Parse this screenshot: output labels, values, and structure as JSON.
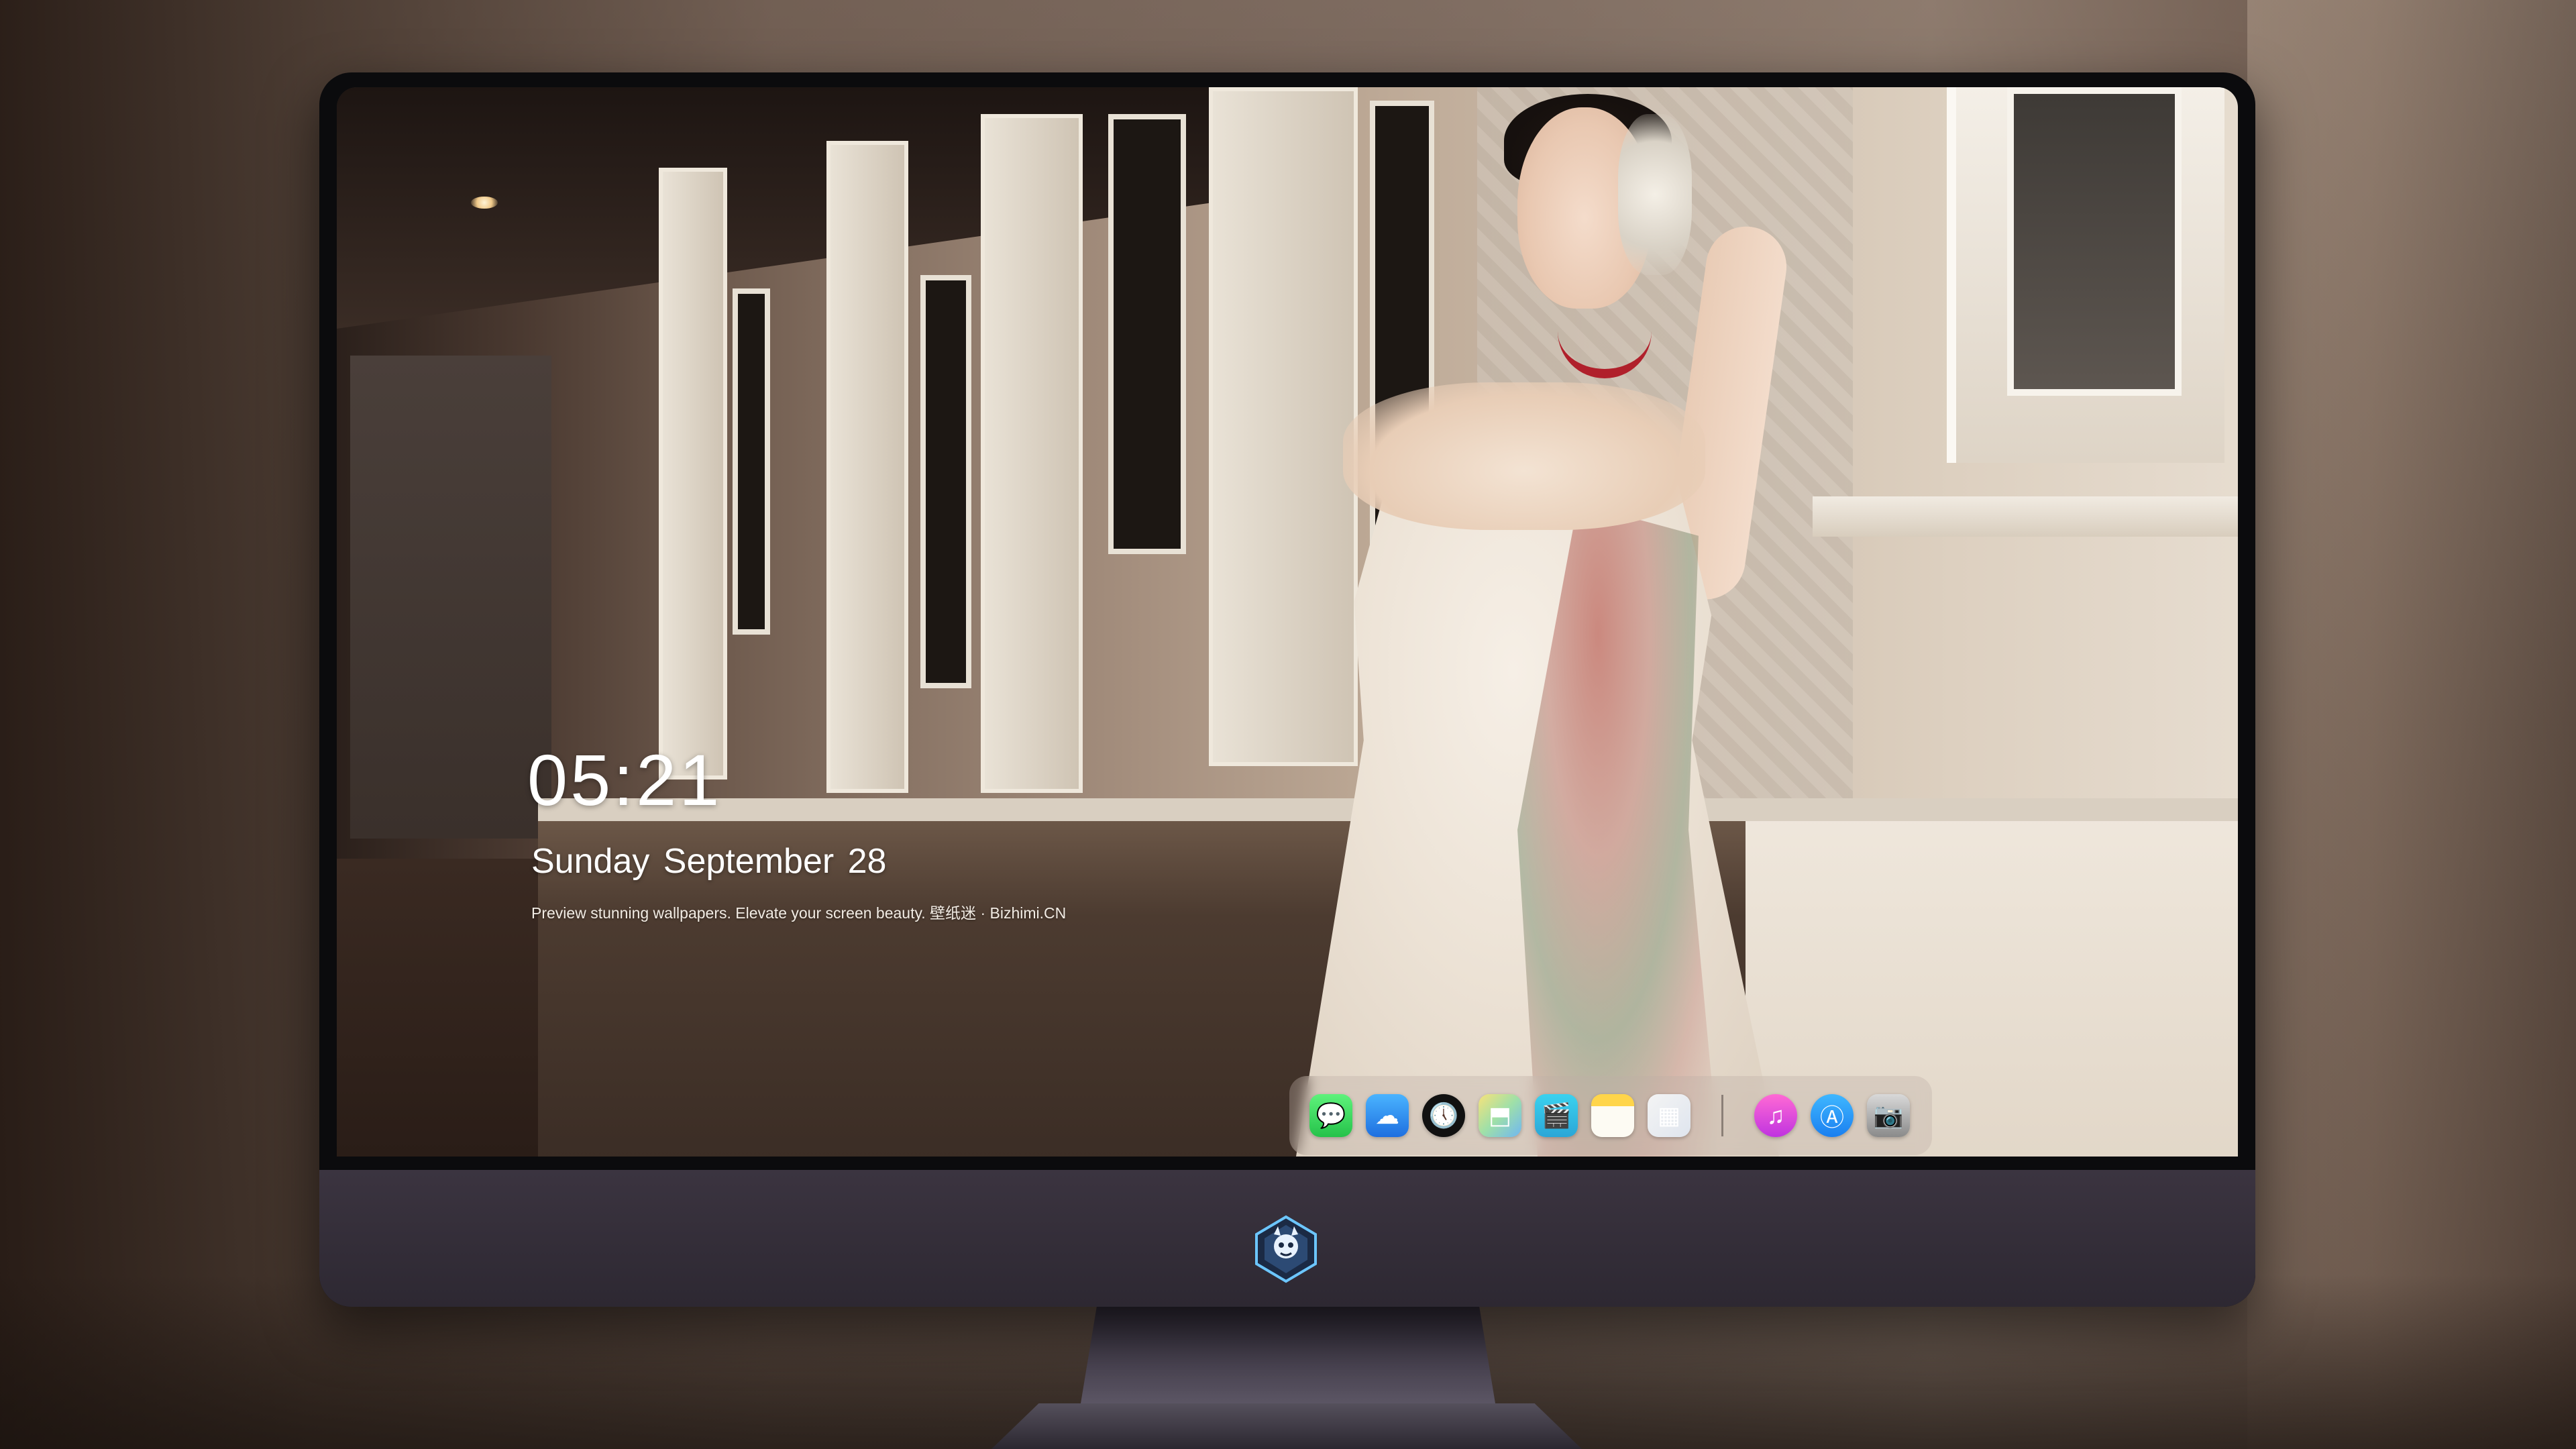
{
  "lockscreen": {
    "time": "05:21",
    "date": "Sunday September  28",
    "tagline": "Preview stunning wallpapers. Elevate your screen beauty. 壁纸迷 · Bizhimi.CN"
  },
  "dock": {
    "apps": [
      {
        "name": "messages-icon",
        "glyph": "💬"
      },
      {
        "name": "weather-icon",
        "glyph": "☁"
      },
      {
        "name": "clock-icon",
        "glyph": "🕔"
      },
      {
        "name": "maps-icon",
        "glyph": "⬒"
      },
      {
        "name": "clips-icon",
        "glyph": "🎬"
      },
      {
        "name": "notes-icon",
        "glyph": ""
      },
      {
        "name": "photos-icon",
        "glyph": "▦"
      },
      {
        "name": "music-icon",
        "glyph": "♫"
      },
      {
        "name": "app-store-icon",
        "glyph": "Ⓐ"
      },
      {
        "name": "camera-icon",
        "glyph": "📷"
      }
    ]
  },
  "colors": {
    "monitor_bezel": "#0b0b0d",
    "monitor_chin": "#342e39",
    "text": "#ffffff"
  }
}
